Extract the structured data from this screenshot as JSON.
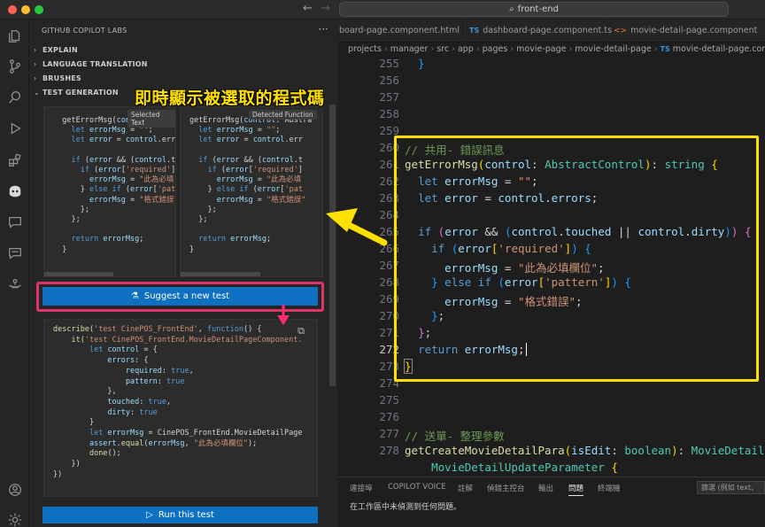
{
  "titlebar": {
    "search": "front-end",
    "back": "←",
    "forward": "→"
  },
  "sidebar": {
    "header": "GITHUB COPILOT LABS",
    "more": "···",
    "sections": [
      {
        "label": "EXPLAIN",
        "chevron": "›"
      },
      {
        "label": "LANGUAGE TRANSLATION",
        "chevron": "›"
      },
      {
        "label": "BRUSHES",
        "chevron": "›"
      },
      {
        "label": "TEST GENERATION",
        "chevron": "⌄"
      }
    ],
    "selected_text_badge": "Selected Text",
    "detected_function_badge": "Detected Function",
    "suggest_button": "Suggest a new test",
    "run_button": "Run this test"
  },
  "annotation": "即時顯示被選取的程式碼",
  "tabs": [
    {
      "label": "board-page.component.html",
      "icon": ""
    },
    {
      "label": "dashboard-page.component.ts",
      "icon": "TS"
    },
    {
      "label": "movie-detail-page.component",
      "icon": "<>"
    }
  ],
  "breadcrumb": [
    "projects",
    "manager",
    "src",
    "app",
    "pages",
    "movie-page",
    "movie-detail-page",
    "movie-detail-page.compon"
  ],
  "breadcrumb_ts": "TS",
  "editor": {
    "line_numbers": [
      "255",
      "256",
      "257",
      "258",
      "259",
      "260",
      "261",
      "262",
      "263",
      "264",
      "265",
      "266",
      "267",
      "268",
      "269",
      "270",
      "271",
      "272",
      "273",
      "274",
      "275",
      "276",
      "277",
      "278"
    ],
    "active_line": "272",
    "comment_260": "// 共用- 錯誤訊息",
    "comment_277": "// 送單- 整理參數",
    "msg_required": "\"此為必填欄位\"",
    "msg_pattern": "\"格式錯誤\""
  },
  "panel": {
    "tabs": [
      "連接埠",
      "COPILOT VOICE",
      "註解",
      "偵錯主控台",
      "輸出",
      "問題",
      "終端機"
    ],
    "active_tab": "問題",
    "filter_placeholder": "篩選 (例如 text、",
    "message": "在工作區中未偵測到任何問題。"
  }
}
